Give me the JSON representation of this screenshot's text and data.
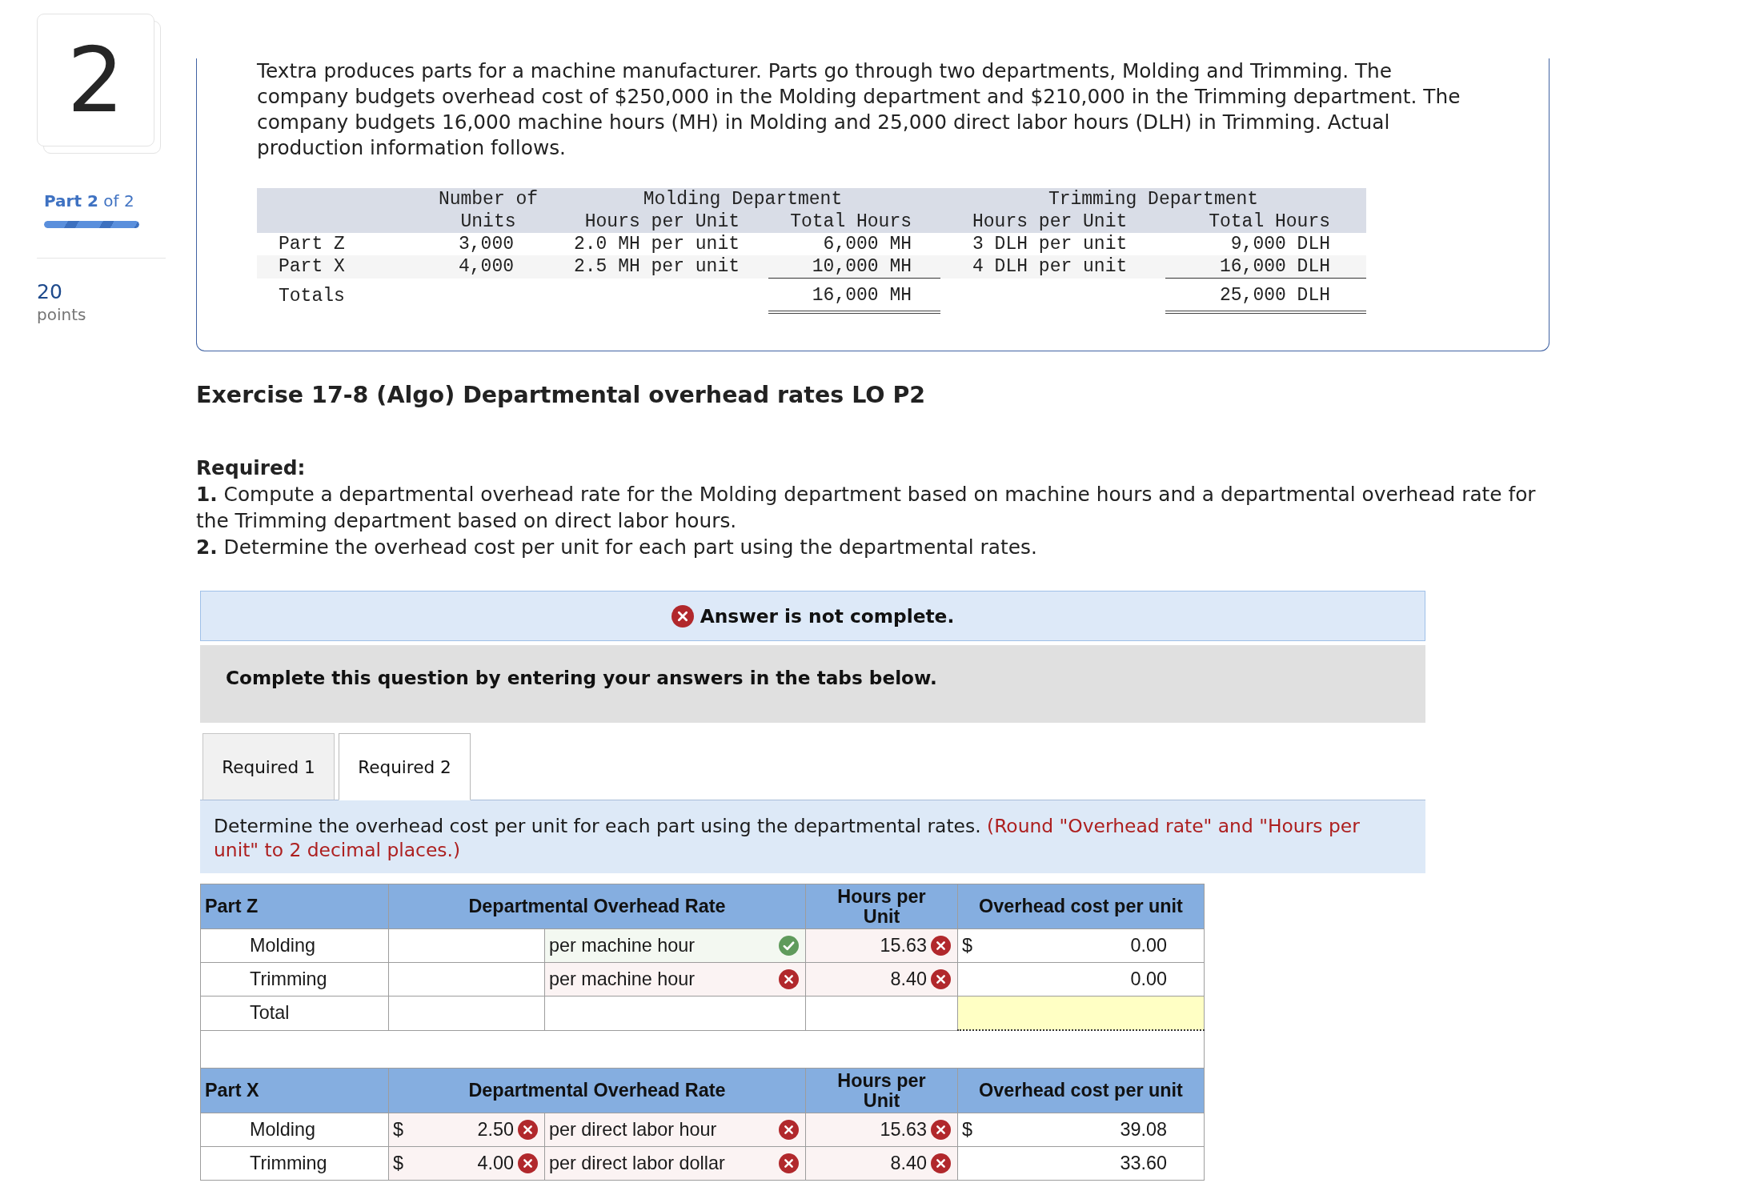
{
  "sidebar": {
    "question_number": "2",
    "part_label": "**Part 2** of 2",
    "progress": {
      "level": 1
    },
    "points_value": "20",
    "points_label": "points"
  },
  "problem": {
    "text": "Textra produces parts for a machine manufacturer. Parts go through two departments, Molding and Trimming. The company budgets overhead cost of $250,000 in the Molding department and $210,000 in the Trimming department. The company budgets 16,000 machine hours (MH) in Molding and 25,000 direct labor hours (DLH) in Trimming. Actual production information follows.",
    "data_table": {
      "column_groups": [
        "Molding Department",
        "Trimming Department"
      ],
      "columns": [
        "Number of Units",
        "Hours per Unit",
        "Total Hours",
        "Hours per Unit",
        "Total Hours"
      ],
      "rows": [
        {
          "label": "Part Z",
          "cells": [
            "3,000",
            "2.0 MH per unit",
            "6,000 MH",
            "3 DLH per unit",
            "9,000 DLH"
          ]
        },
        {
          "label": "Part X",
          "cells": [
            "4,000",
            "2.5 MH per unit",
            "10,000 MH",
            "4 DLH per unit",
            "16,000 DLH"
          ]
        }
      ],
      "totals": {
        "label": "Totals",
        "molding_total": "16,000 MH",
        "trimming_total": "25,000 DLH"
      }
    }
  },
  "exercise_title": "Exercise 17-8 (Algo) Departmental overhead rates LO P2",
  "required": {
    "heading": "Required:",
    "items": [
      "**1.** Compute a departmental overhead rate for the Molding department based on machine hours and a departmental overhead rate for the Trimming department based on direct labor hours.",
      "**2.** Determine the overhead cost per unit for each part using the departmental rates."
    ]
  },
  "result_banner": {
    "complete": false,
    "text": "Answer is not complete."
  },
  "instruction_box": {
    "text": "Complete this question by entering your answers in the tabs below."
  },
  "tabs": [
    {
      "label": "Required 1",
      "selected": false
    },
    {
      "label": "Required 2",
      "selected": true
    }
  ],
  "tab_panel": {
    "instruction": "Determine the overhead cost per unit for each part using the departmental rates.",
    "rounding_note": "(Round \"Overhead rate\" and \"Hours per unit\" to 2 decimal places.)"
  },
  "answer_tables": [
    {
      "header": {
        "part": "Part Z",
        "rate": "Departmental Overhead Rate",
        "hours": "Hours per Unit",
        "cost": "Overhead cost per unit"
      },
      "rows": [
        {
          "kind": "entry",
          "label": "Molding",
          "rate_unit": {
            "value": "per machine hour",
            "correct": true
          },
          "hours": {
            "value": "15.63",
            "correct": false
          },
          "cost": {
            "currency": "$",
            "value": "0.00"
          }
        },
        {
          "kind": "entry",
          "label": "Trimming",
          "rate_unit": {
            "value": "per machine hour",
            "correct": false
          },
          "hours": {
            "value": "8.40",
            "correct": false
          },
          "cost": {
            "value": "0.00"
          }
        },
        {
          "kind": "total",
          "label": "Total"
        }
      ]
    },
    {
      "header": {
        "part": "Part X",
        "rate": "Departmental Overhead Rate",
        "hours": "Hours per Unit",
        "cost": "Overhead cost per unit"
      },
      "rows": [
        {
          "kind": "entry",
          "label": "Molding",
          "rate_amount": {
            "currency": "$",
            "value": "2.50",
            "correct": false
          },
          "rate_unit": {
            "value": "per direct labor hour",
            "correct": false
          },
          "hours": {
            "value": "15.63",
            "correct": false
          },
          "cost": {
            "currency": "$",
            "value": "39.08"
          }
        },
        {
          "kind": "entry",
          "label": "Trimming",
          "rate_amount": {
            "currency": "$",
            "value": "4.00",
            "correct": false
          },
          "rate_unit": {
            "value": "per direct labor dollar",
            "correct": false
          },
          "hours": {
            "value": "8.40",
            "correct": false
          },
          "cost": {
            "value": "33.60"
          }
        }
      ]
    }
  ]
}
